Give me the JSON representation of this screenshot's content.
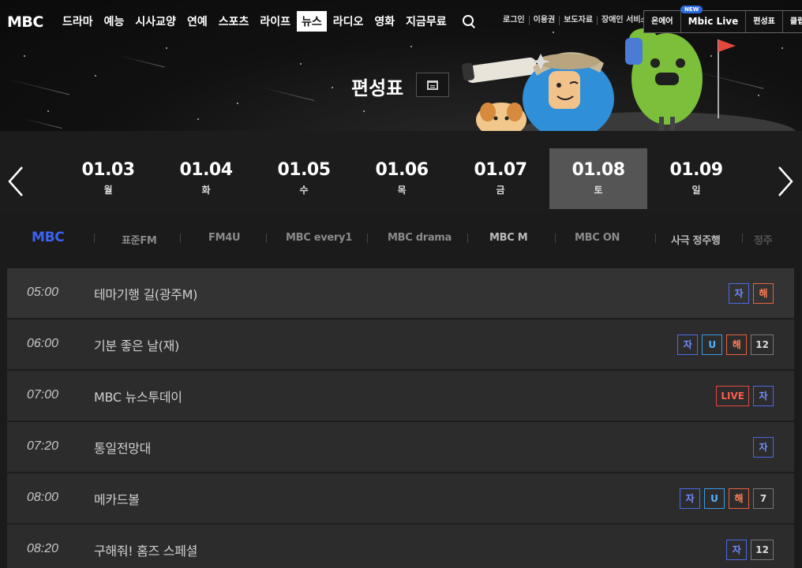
{
  "header": {
    "logo": "MBC",
    "menu": [
      "드라마",
      "예능",
      "시사교양",
      "연예",
      "스포츠",
      "라이프",
      "뉴스",
      "라디오",
      "영화",
      "지금무료"
    ],
    "active_menu_index": 6,
    "util_links": [
      "로그인",
      "이용권",
      "보도자료",
      "장애인 서비스"
    ],
    "quick_links": [
      "온에어",
      "Mbic Live",
      "편성표",
      "클립"
    ],
    "new_badge": "NEW",
    "icons": [
      "search-icon",
      "calendar-icon"
    ]
  },
  "hero": {
    "title": "편성표"
  },
  "dates": [
    {
      "date": "01.03",
      "dow": "월"
    },
    {
      "date": "01.04",
      "dow": "화"
    },
    {
      "date": "01.05",
      "dow": "수"
    },
    {
      "date": "01.06",
      "dow": "목"
    },
    {
      "date": "01.07",
      "dow": "금"
    },
    {
      "date": "01.08",
      "dow": "토"
    },
    {
      "date": "01.09",
      "dow": "일"
    }
  ],
  "active_date_index": 5,
  "channels": [
    "MBC",
    "표준FM",
    "FM4U",
    "MBC every1",
    "MBC drama",
    "MBC M",
    "MBC ON",
    "사극 정주행",
    "정주"
  ],
  "active_channel_index": 0,
  "schedule": [
    {
      "time": "05:00",
      "title": "테마기행 길(광주M)",
      "badges": [
        "자",
        "해"
      ]
    },
    {
      "time": "06:00",
      "title": "기분 좋은 날(재)",
      "badges": [
        "자",
        "U",
        "해",
        "12"
      ]
    },
    {
      "time": "07:00",
      "title": "MBC 뉴스투데이",
      "badges": [
        "LIVE",
        "자"
      ]
    },
    {
      "time": "07:20",
      "title": "통일전망대",
      "badges": [
        "자"
      ]
    },
    {
      "time": "08:00",
      "title": "메카드볼",
      "badges": [
        "자",
        "U",
        "해",
        "7"
      ]
    },
    {
      "time": "08:20",
      "title": "구해줘! 홈즈 스페셜",
      "badges": [
        "자",
        "12"
      ]
    }
  ],
  "colors": {
    "active_channel": "#3b63f3",
    "badge_ja": "#6f8cff",
    "badge_u": "#55b3ff",
    "badge_hae": "#ff7d55",
    "badge_live": "#ff5c4c"
  }
}
